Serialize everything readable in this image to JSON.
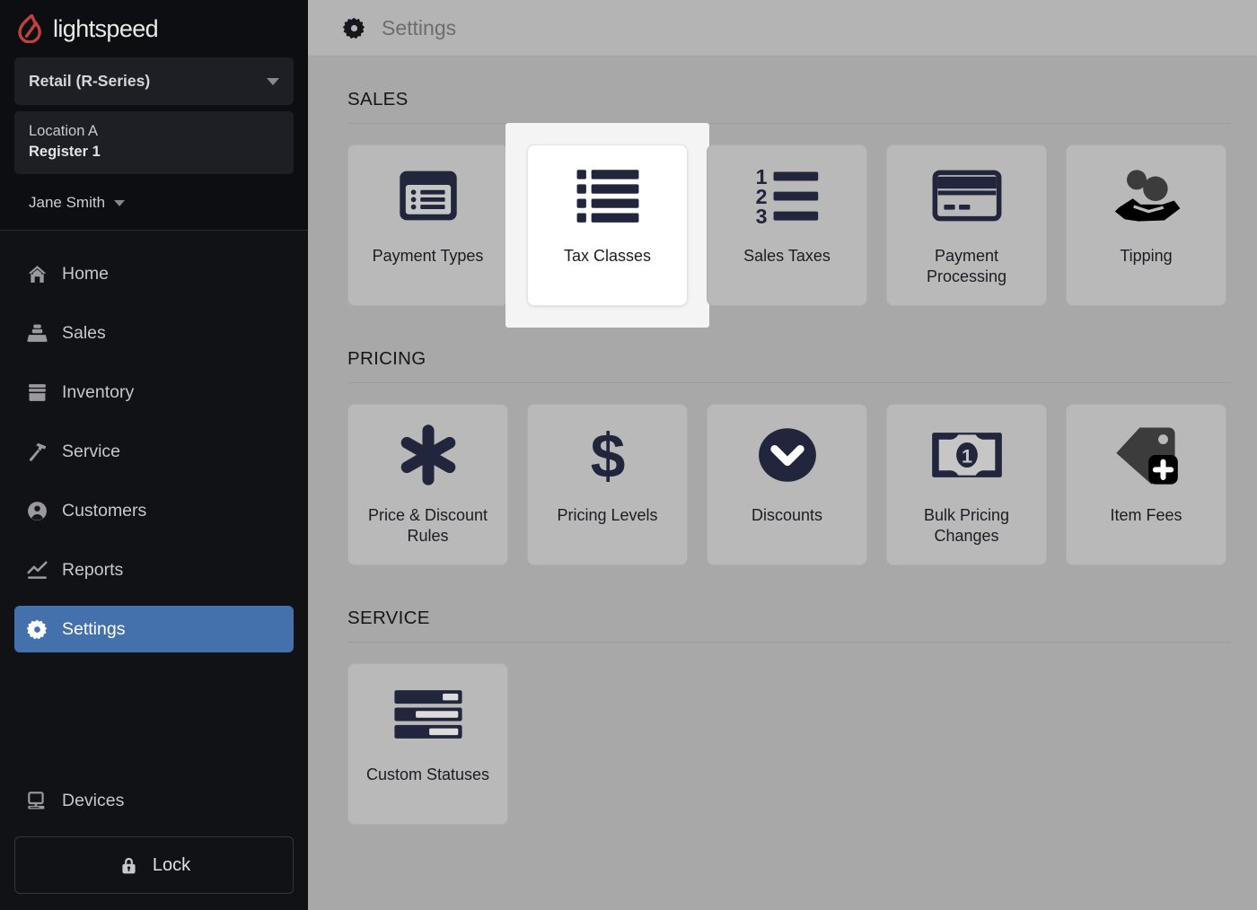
{
  "sidebar": {
    "logo_text": "lightspeed",
    "logo_icon": "lightspeed-flame-icon",
    "product_picker": {
      "label": "Retail (R-Series)",
      "icon": "chevron-down-icon"
    },
    "location": {
      "line1": "Location A",
      "line2": "Register 1"
    },
    "user": {
      "name": "Jane Smith",
      "icon": "chevron-down-icon"
    },
    "nav_items": [
      {
        "label": "Home",
        "icon": "home-icon",
        "active": false
      },
      {
        "label": "Sales",
        "icon": "register-icon",
        "active": false
      },
      {
        "label": "Inventory",
        "icon": "inventory-box-icon",
        "active": false
      },
      {
        "label": "Service",
        "icon": "hammer-icon",
        "active": false
      },
      {
        "label": "Customers",
        "icon": "user-circle-icon",
        "active": false
      },
      {
        "label": "Reports",
        "icon": "line-chart-icon",
        "active": false
      },
      {
        "label": "Settings",
        "icon": "gear-icon",
        "active": true
      }
    ],
    "devices": {
      "label": "Devices",
      "icon": "monitor-icon"
    },
    "lock": {
      "label": "Lock",
      "icon": "lock-icon"
    },
    "active_color": "#4471ab"
  },
  "header": {
    "title": "Settings",
    "icon": "gear-icon"
  },
  "sections": [
    {
      "title": "SALES",
      "tiles": [
        {
          "label": "Payment Types",
          "icon": "payment-types-icon",
          "selected": false
        },
        {
          "label": "Tax Classes",
          "icon": "list-bars-icon",
          "selected": true
        },
        {
          "label": "Sales Taxes",
          "icon": "numbered-list-icon",
          "selected": false
        },
        {
          "label": "Payment Processing",
          "icon": "credit-card-icon",
          "selected": false
        },
        {
          "label": "Tipping",
          "icon": "hand-coins-icon",
          "selected": false
        }
      ]
    },
    {
      "title": "PRICING",
      "tiles": [
        {
          "label": "Price & Discount Rules",
          "icon": "asterisk-icon",
          "selected": false
        },
        {
          "label": "Pricing Levels",
          "icon": "dollar-sign-icon",
          "selected": false
        },
        {
          "label": "Discounts",
          "icon": "circle-chevron-down-icon",
          "selected": false
        },
        {
          "label": "Bulk Pricing Changes",
          "icon": "banknote-icon",
          "selected": false
        },
        {
          "label": "Item Fees",
          "icon": "tag-plus-icon",
          "selected": false
        }
      ]
    },
    {
      "title": "SERVICE",
      "tiles": [
        {
          "label": "Custom Statuses",
          "icon": "status-bars-icon",
          "selected": false
        }
      ]
    }
  ],
  "colors": {
    "sidebar_bg": "#111216",
    "sidebar_top_bg": "#0d0e11",
    "active_nav": "#4471ab",
    "page_bg": "#a8a8a8",
    "topbar_bg": "#b4b4b4",
    "tile_bg": "#b9b9b9",
    "tile_selected_bg": "#ffffff",
    "icon_navy": "#22263c",
    "logo_red": "#c0413e"
  }
}
